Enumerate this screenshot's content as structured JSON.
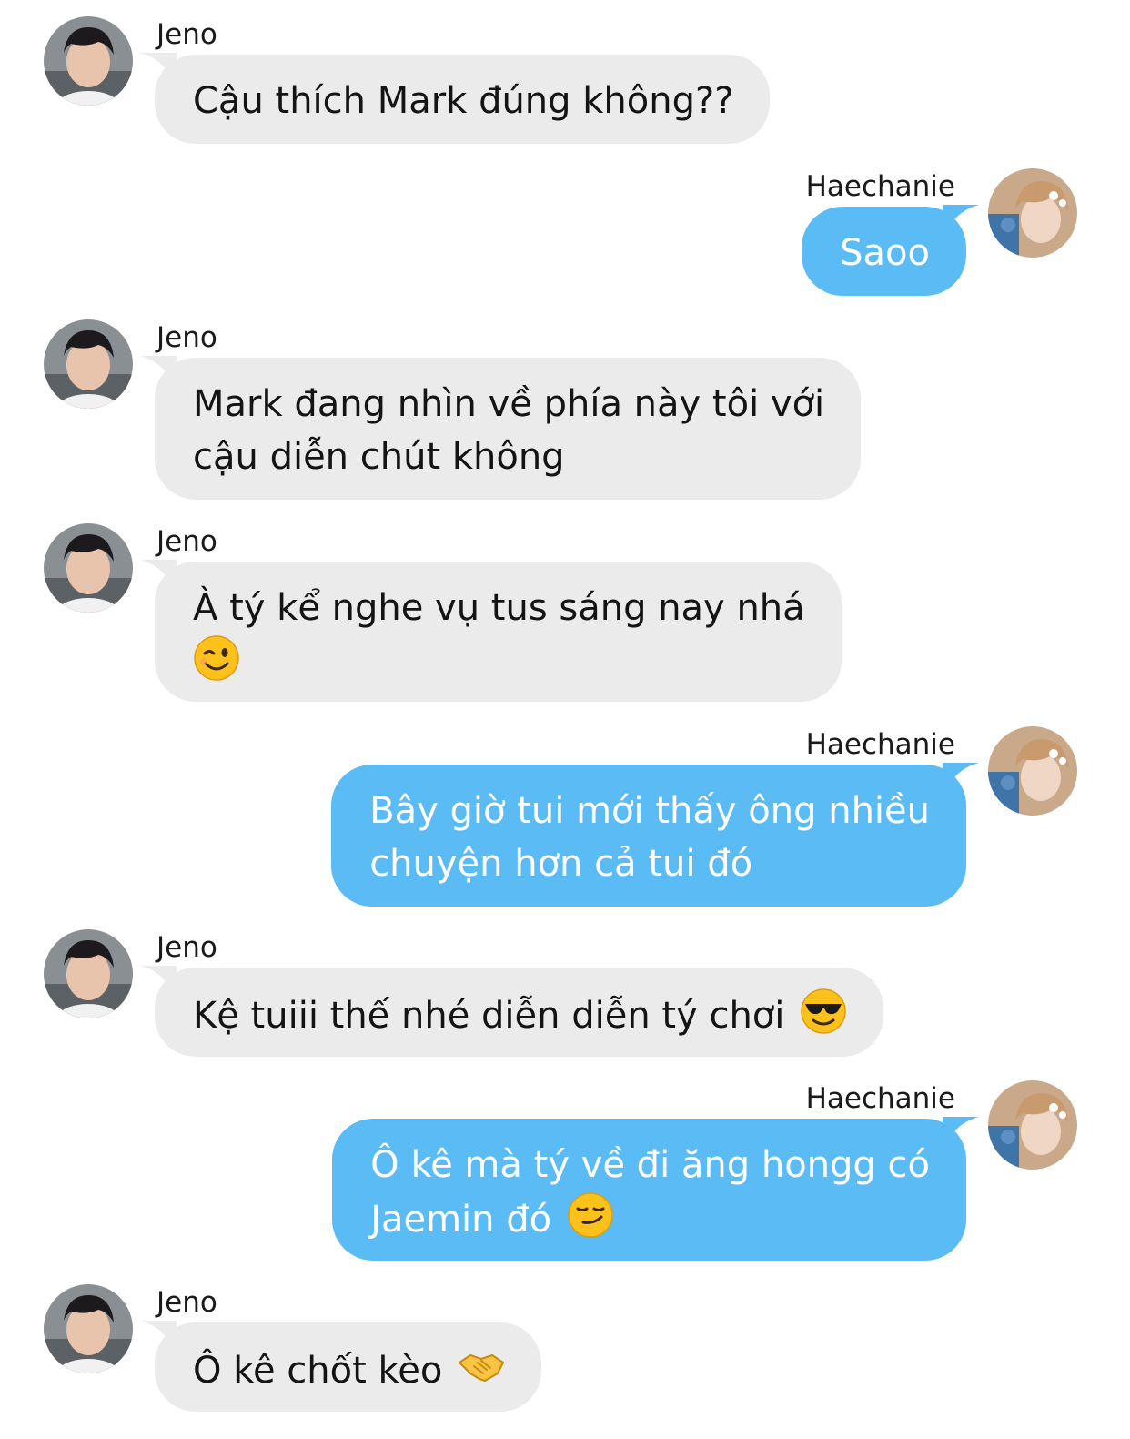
{
  "messages": [
    {
      "side": "left",
      "sender": "Jeno",
      "text": "Cậu thích Mark đúng không??",
      "emoji": ""
    },
    {
      "side": "right",
      "sender": "Haechanie",
      "text": "Saoo",
      "emoji": ""
    },
    {
      "side": "left",
      "sender": "Jeno",
      "text": "Mark đang nhìn về phía này tôi với\ncậu diễn chút không",
      "emoji": ""
    },
    {
      "side": "left",
      "sender": "Jeno",
      "text": "À tý kể nghe vụ tus sáng nay nhá\n",
      "emoji": "winking-face-emoji"
    },
    {
      "side": "right",
      "sender": "Haechanie",
      "text": "Bây giờ tui mới thấy ông nhiều\nchuyện hơn cả tui đó",
      "emoji": ""
    },
    {
      "side": "left",
      "sender": "Jeno",
      "text": "Kệ tuiii thế nhé diễn diễn tý chơi ",
      "emoji": "smiling-face-with-sunglasses-emoji"
    },
    {
      "side": "right",
      "sender": "Haechanie",
      "text": "Ô kê mà tý về đi ăng hongg có\nJaemin đó ",
      "emoji": "smirking-face-emoji"
    },
    {
      "side": "left",
      "sender": "Jeno",
      "text": "Ô kê chốt kèo ",
      "emoji": "handshake-emoji"
    }
  ],
  "colors": {
    "left_bubble": "#ebebeb",
    "right_bubble": "#5bbcf5",
    "left_text": "#141414",
    "right_text": "#ffffff"
  }
}
